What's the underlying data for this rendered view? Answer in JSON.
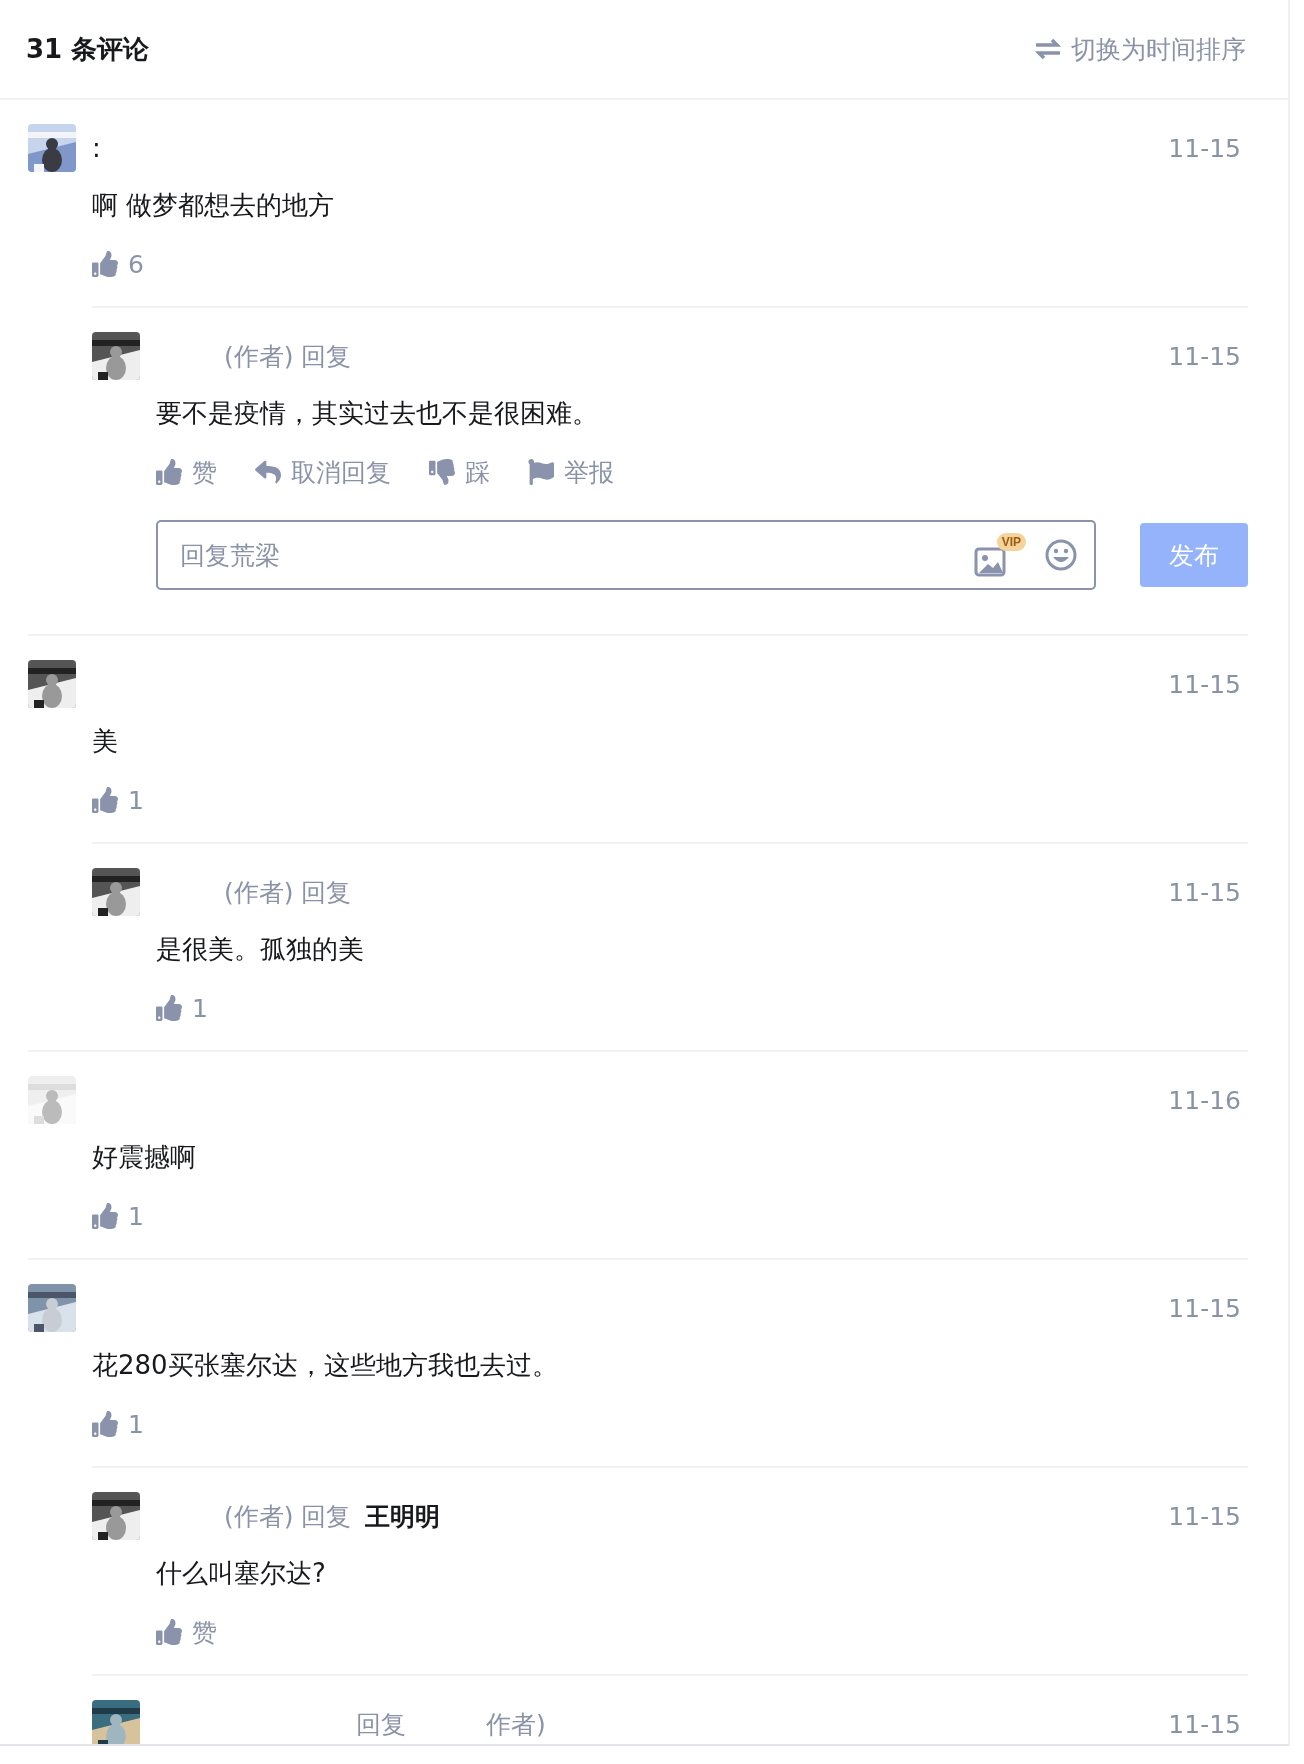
{
  "header": {
    "title": "31 条评论",
    "sort_link": "切换为时间排序"
  },
  "comments": [
    {
      "avatar": {
        "kind": "picture"
      },
      "name": ":",
      "time": "11-15",
      "text": "啊 做梦都想去的地方",
      "likes": "6",
      "replies": [
        {
          "kind": "full",
          "avatar": {
            "kind": "picture"
          },
          "reply_label": "(作者) 回复",
          "time": "11-15",
          "text": "要不是疫情，其实过去也不是很困难。",
          "actions": [
            {
              "kind": "like",
              "label": "赞"
            },
            {
              "kind": "reply",
              "label": "取消回复"
            },
            {
              "kind": "dislike",
              "label": "踩"
            },
            {
              "kind": "report",
              "label": "举报"
            }
          ],
          "composer": {
            "placeholder": "回复荒梁",
            "badge": "VIP",
            "button": "发布"
          }
        }
      ]
    },
    {
      "avatar": {
        "kind": "picture"
      },
      "time": "11-15",
      "text": "美",
      "likes": "1",
      "replies": [
        {
          "kind": "full",
          "avatar": {
            "kind": "picture"
          },
          "reply_label": "(作者) 回复",
          "time": "11-15",
          "text": "是很美。孤独的美",
          "actions": [
            {
              "kind": "like",
              "label": "1"
            }
          ]
        }
      ]
    },
    {
      "avatar": {
        "kind": "picture"
      },
      "time": "11-16",
      "text": "好震撼啊",
      "likes": "1"
    },
    {
      "avatar": {
        "kind": "picture"
      },
      "time": "11-15",
      "text": "花280买张塞尔达，这些地方我也去过。",
      "likes": "1",
      "replies": [
        {
          "kind": "full",
          "avatar": {
            "kind": "picture"
          },
          "reply_label": "(作者) 回复",
          "target": "王明明",
          "time": "11-15",
          "text": "什么叫塞尔达?",
          "actions": [
            {
              "kind": "like",
              "label": "赞"
            }
          ]
        },
        {
          "kind": "partial",
          "avatar": {
            "kind": "picture"
          },
          "segments": [
            "回复",
            "作者)"
          ],
          "time": "11-15"
        }
      ]
    }
  ]
}
